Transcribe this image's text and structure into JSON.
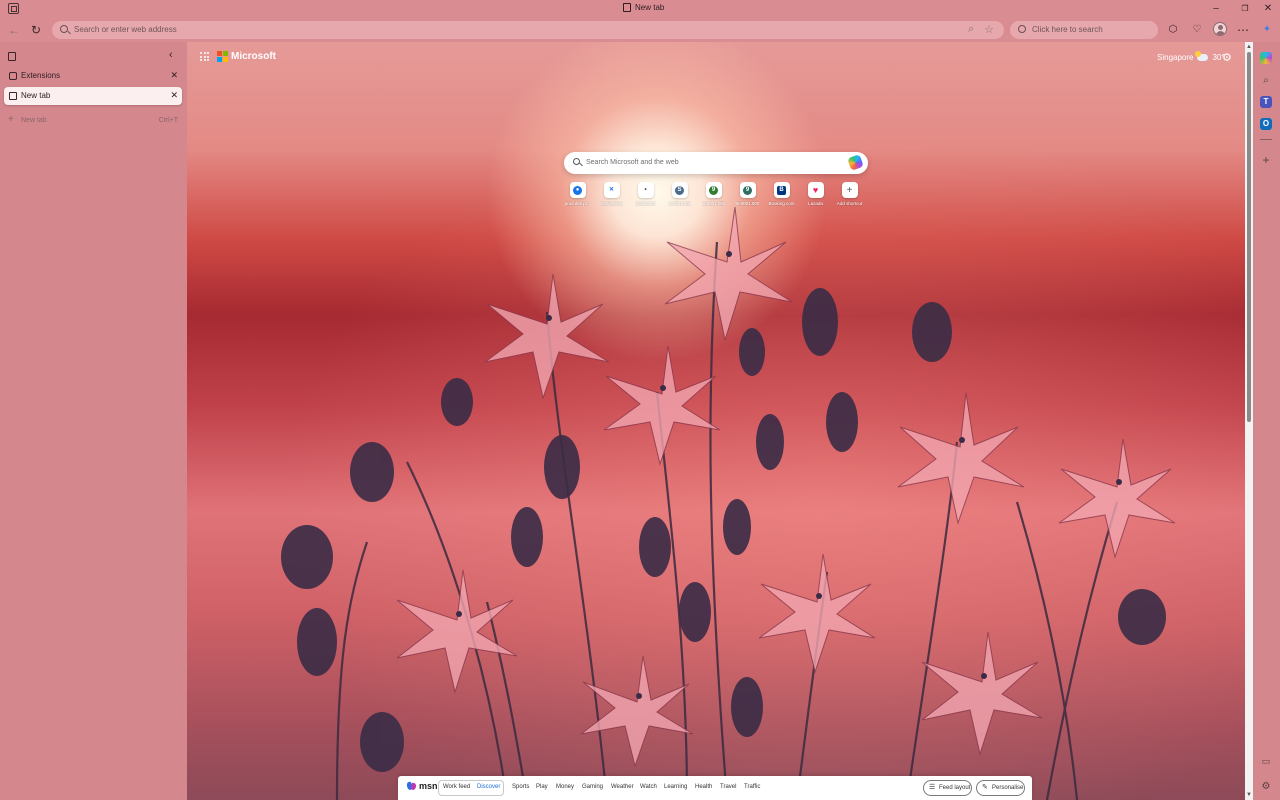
{
  "window": {
    "title": "New tab",
    "controls": [
      "minimize-icon",
      "restore-icon",
      "close-icon"
    ]
  },
  "toolbar": {
    "address_placeholder": "Search or enter web address",
    "search_placeholder": "Click here to search"
  },
  "sidebar": {
    "tabs": [
      {
        "label": "Extensions",
        "active": false
      },
      {
        "label": "New tab",
        "active": true
      }
    ],
    "new_tab": {
      "label": "New tab",
      "shortcut": "Ctrl+T"
    }
  },
  "page": {
    "brand": "Microsoft",
    "weather": {
      "location": "Singapore",
      "temp": "30°"
    },
    "search_placeholder": "Search Microsoft and the web",
    "shortcuts": [
      {
        "name": "prod.dev.pl...",
        "color": "#1a73e8",
        "glyph": "●"
      },
      {
        "name": "Google/Dev",
        "color": "#1a73e8",
        "glyph": "✕"
      },
      {
        "name": "localhost:3",
        "color": "#444444",
        "glyph": "•"
      },
      {
        "name": "ts-0001.000",
        "color": "#4a6a8a",
        "glyph": "S"
      },
      {
        "name": "ts-0001.000",
        "color": "#2e7d32",
        "glyph": "9"
      },
      {
        "name": "ts-0001.000",
        "color": "#2e6f62",
        "glyph": "9"
      },
      {
        "name": "Booking.com",
        "color": "#003580",
        "glyph": "B"
      },
      {
        "name": "Lazada",
        "color": "#f0245a",
        "glyph": "♥"
      },
      {
        "name": "Add shortcut",
        "color": "#ffffff",
        "glyph": "+"
      }
    ]
  },
  "msn": {
    "brand": "msn",
    "tabs": [
      "Work feed",
      "Discover",
      "Sports",
      "Play",
      "Money",
      "Gaming",
      "Weather",
      "Watch",
      "Learning",
      "Health",
      "Travel",
      "Traffic"
    ],
    "active_tab": "Discover",
    "feed_layout": "Feed layout",
    "personalise": "Personalise"
  },
  "colors": {
    "chrome": "#d98d93",
    "sidebar": "#d4888e",
    "accent": "#1a6fd6"
  }
}
